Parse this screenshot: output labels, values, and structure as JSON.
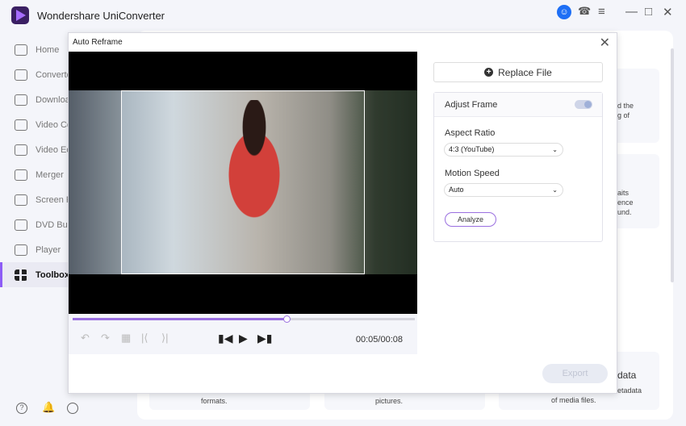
{
  "app": {
    "title": "Wondershare UniConverter"
  },
  "sidebar": {
    "items": [
      {
        "label": "Home",
        "icon": "home-icon"
      },
      {
        "label": "Converte",
        "icon": "converter-icon"
      },
      {
        "label": "Downloa",
        "icon": "download-icon"
      },
      {
        "label": "Video Co",
        "icon": "video-compress-icon"
      },
      {
        "label": "Video Ed",
        "icon": "scissors-icon"
      },
      {
        "label": "Merger",
        "icon": "merger-icon"
      },
      {
        "label": "Screen R",
        "icon": "screen-record-icon"
      },
      {
        "label": "DVD Bur",
        "icon": "dvd-icon"
      },
      {
        "label": "Player",
        "icon": "player-icon"
      },
      {
        "label": "Toolbox",
        "icon": "toolbox-icon",
        "active": true
      }
    ]
  },
  "background": {
    "card1": [
      "d the",
      "g of"
    ],
    "card2": [
      "aits",
      "ence",
      "und."
    ],
    "card3_title": "data",
    "card3": [
      "etadata",
      "of media files."
    ],
    "bottom1": "formats.",
    "bottom2": "pictures."
  },
  "dialog": {
    "title": "Auto Reframe",
    "replace_label": "Replace File",
    "adjust_frame_label": "Adjust Frame",
    "adjust_frame_on": true,
    "aspect_ratio_label": "Aspect Ratio",
    "aspect_ratio_value": "4:3 (YouTube)",
    "motion_speed_label": "Motion Speed",
    "motion_speed_value": "Auto",
    "analyze_label": "Analyze",
    "export_label": "Export",
    "time": "00:05/00:08",
    "progress": 0.625
  },
  "colors": {
    "accent": "#8d5cf6",
    "avatar": "#1e6ff5"
  }
}
